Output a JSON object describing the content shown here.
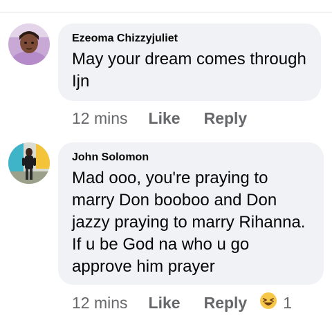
{
  "comments": [
    {
      "author": "Ezeoma Chizzyjuliet",
      "text": "May your dream comes through Ijn",
      "time": "12 mins",
      "like_label": "Like",
      "reply_label": "Reply"
    },
    {
      "author": "John Solomon",
      "text": "Mad ooo, you're praying to marry Don booboo and Don jazzy praying to marry Rihanna. If u be God na who u go approve him prayer",
      "time": "12 mins",
      "like_label": "Like",
      "reply_label": "Reply",
      "reaction": {
        "icon": "laughing-emoji-icon",
        "count": "1"
      }
    }
  ],
  "colors": {
    "bubble_bg": "#f0f2f5",
    "action_text": "#65676b",
    "author_text": "#050505"
  }
}
